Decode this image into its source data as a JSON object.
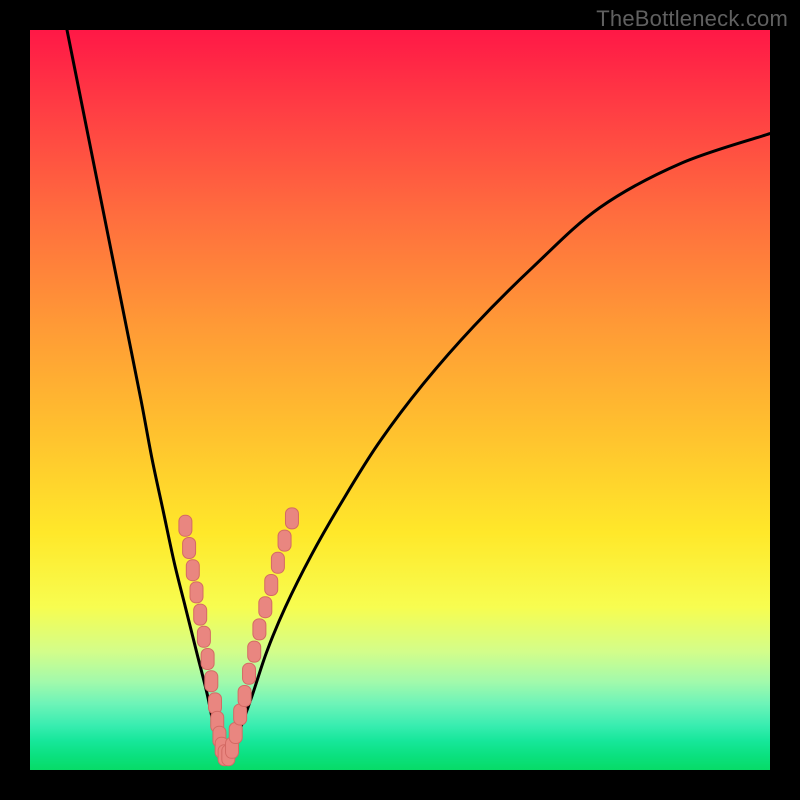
{
  "watermark": "TheBottleneck.com",
  "colors": {
    "frame": "#000000",
    "curve": "#000000",
    "marker_fill": "#e98680",
    "marker_stroke": "#d46a64",
    "gradient_stops": [
      "#ff1846",
      "#ff3b44",
      "#ff6d3e",
      "#ff9a36",
      "#ffc32e",
      "#ffe82a",
      "#f7fd50",
      "#d3fd8a",
      "#a3faab",
      "#6ef4b8",
      "#38edb0",
      "#17e79b",
      "#0be180",
      "#07db67"
    ]
  },
  "chart_data": {
    "type": "line",
    "title": "",
    "xlabel": "",
    "ylabel": "",
    "xlim": [
      0,
      100
    ],
    "ylim": [
      0,
      100
    ],
    "grid": false,
    "series": [
      {
        "name": "curve-left",
        "x": [
          5,
          7,
          9,
          11,
          13,
          15,
          16.5,
          18,
          19.5,
          21,
          22.5,
          24,
          25,
          25.8
        ],
        "y": [
          100,
          90,
          80,
          70,
          60,
          50,
          42,
          35,
          28,
          22,
          16,
          10,
          5,
          2
        ]
      },
      {
        "name": "curve-right",
        "x": [
          27,
          28.2,
          30,
          32,
          34.5,
          38,
          42,
          47,
          53,
          60,
          68,
          77,
          88,
          100
        ],
        "y": [
          2,
          5,
          10,
          16,
          22,
          29,
          36,
          44,
          52,
          60,
          68,
          76,
          82,
          86
        ]
      },
      {
        "name": "floor",
        "x": [
          25.8,
          27
        ],
        "y": [
          2,
          2
        ]
      }
    ],
    "markers": [
      {
        "x": 21.0,
        "y": 33.0
      },
      {
        "x": 21.5,
        "y": 30.0
      },
      {
        "x": 22.0,
        "y": 27.0
      },
      {
        "x": 22.5,
        "y": 24.0
      },
      {
        "x": 23.0,
        "y": 21.0
      },
      {
        "x": 23.5,
        "y": 18.0
      },
      {
        "x": 24.0,
        "y": 15.0
      },
      {
        "x": 24.5,
        "y": 12.0
      },
      {
        "x": 25.0,
        "y": 9.0
      },
      {
        "x": 25.3,
        "y": 6.5
      },
      {
        "x": 25.6,
        "y": 4.5
      },
      {
        "x": 25.9,
        "y": 3.0
      },
      {
        "x": 26.3,
        "y": 2.0
      },
      {
        "x": 26.8,
        "y": 2.0
      },
      {
        "x": 27.3,
        "y": 3.0
      },
      {
        "x": 27.8,
        "y": 5.0
      },
      {
        "x": 28.4,
        "y": 7.5
      },
      {
        "x": 29.0,
        "y": 10.0
      },
      {
        "x": 29.6,
        "y": 13.0
      },
      {
        "x": 30.3,
        "y": 16.0
      },
      {
        "x": 31.0,
        "y": 19.0
      },
      {
        "x": 31.8,
        "y": 22.0
      },
      {
        "x": 32.6,
        "y": 25.0
      },
      {
        "x": 33.5,
        "y": 28.0
      },
      {
        "x": 34.4,
        "y": 31.0
      },
      {
        "x": 35.4,
        "y": 34.0
      }
    ]
  }
}
